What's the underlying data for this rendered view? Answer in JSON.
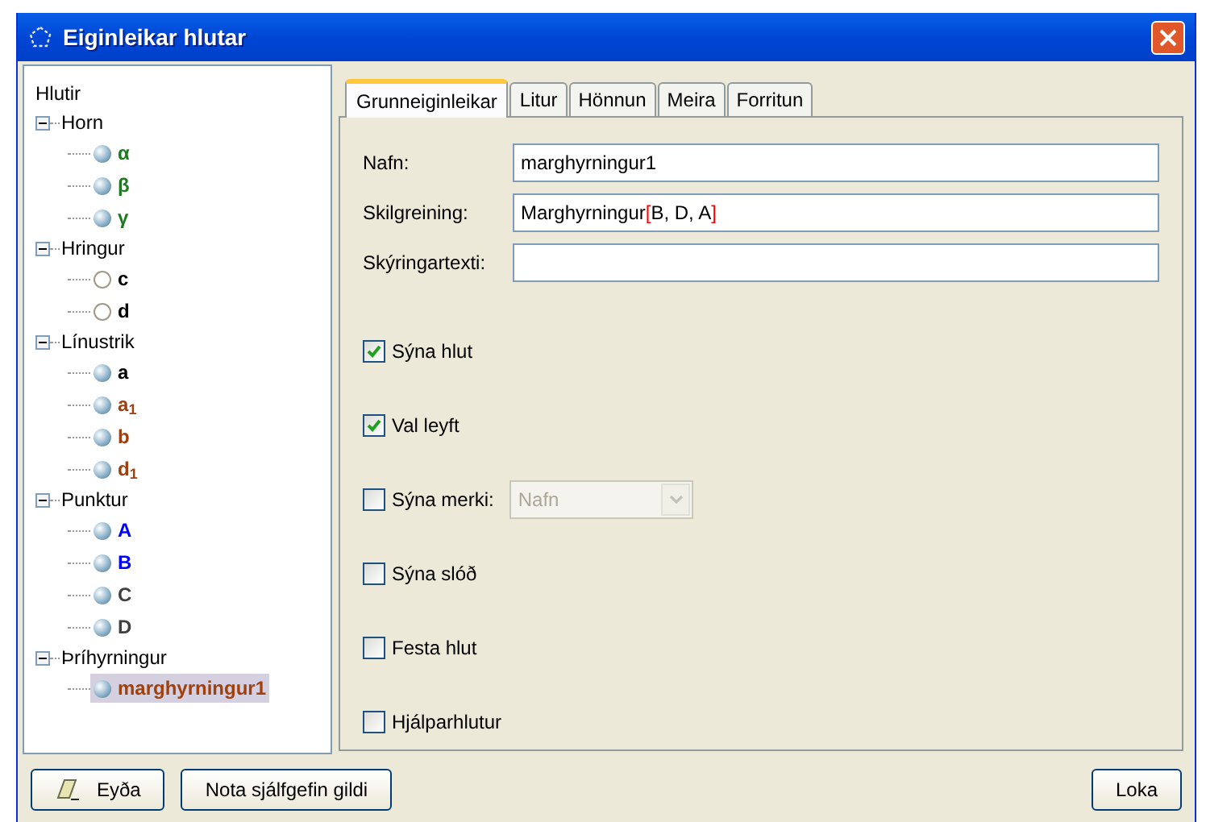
{
  "window": {
    "title": "Eiginleikar hlutar"
  },
  "tree": {
    "label": "Hlutir",
    "groups": [
      {
        "label": "Horn",
        "expanded": true,
        "children": [
          {
            "label": "α",
            "color": "#1e7a1e",
            "shown": true,
            "selected": false
          },
          {
            "label": "β",
            "color": "#1e7a1e",
            "shown": true,
            "selected": false
          },
          {
            "label": "γ",
            "color": "#1e7a1e",
            "shown": true,
            "selected": false
          }
        ]
      },
      {
        "label": "Hringur",
        "expanded": true,
        "children": [
          {
            "label": "c",
            "color": "#000000",
            "shown": false,
            "selected": false
          },
          {
            "label": "d",
            "color": "#000000",
            "shown": false,
            "selected": false
          }
        ]
      },
      {
        "label": "Línustrik",
        "expanded": true,
        "children": [
          {
            "label": "a",
            "color": "#000000",
            "shown": true,
            "selected": false
          },
          {
            "label": "a$_{1}$",
            "color": "#a0400f",
            "shown": true,
            "selected": false
          },
          {
            "label": "b",
            "color": "#a0400f",
            "shown": true,
            "selected": false
          },
          {
            "label": "d$_{1}$",
            "color": "#a0400f",
            "shown": true,
            "selected": false
          }
        ]
      },
      {
        "label": "Punktur",
        "expanded": true,
        "children": [
          {
            "label": "A",
            "color": "#0000ff",
            "shown": true,
            "selected": false
          },
          {
            "label": "B",
            "color": "#0000ff",
            "shown": true,
            "selected": false
          },
          {
            "label": "C",
            "color": "#404040",
            "shown": true,
            "selected": false
          },
          {
            "label": "D",
            "color": "#404040",
            "shown": true,
            "selected": false
          }
        ]
      },
      {
        "label": "Þríhyrningur",
        "expanded": true,
        "children": [
          {
            "label": "marghyrningur1",
            "color": "#a0400f",
            "shown": true,
            "selected": true
          }
        ]
      }
    ]
  },
  "tabs": [
    {
      "label": "Grunneiginleikar",
      "selected": true
    },
    {
      "label": "Litur",
      "selected": false
    },
    {
      "label": "Hönnun",
      "selected": false
    },
    {
      "label": "Meira",
      "selected": false
    },
    {
      "label": "Forritun",
      "selected": false
    }
  ],
  "fields": [
    {
      "label": "Nafn:",
      "segments": [
        {
          "text": "marghyrningur1",
          "kind": "plain"
        }
      ]
    },
    {
      "label": "Skilgreining:",
      "segments": [
        {
          "text": "Marghyrningur",
          "kind": "plain"
        },
        {
          "text": "[",
          "kind": "bracket"
        },
        {
          "text": "B, D, A",
          "kind": "plain"
        },
        {
          "text": "]",
          "kind": "bracket"
        }
      ]
    },
    {
      "label": "Skýringartexti:"
    }
  ],
  "checkboxes": [
    {
      "label": "Sýna hlut",
      "checked": true
    },
    {
      "label": "Val leyft",
      "checked": true
    },
    {
      "label": "Sýna merki:",
      "checked": false,
      "dropdown": {
        "value": "Nafn",
        "disabled": true
      }
    },
    {
      "label": "Sýna slóð",
      "checked": false
    },
    {
      "label": "Festa hlut",
      "checked": false
    },
    {
      "label": "Hjálparhlutur",
      "checked": false
    }
  ],
  "buttons": [
    {
      "label": "Eyða",
      "kind": "delete"
    },
    {
      "label": "Nota sjálfgefin gildi",
      "kind": "plain"
    },
    {
      "label": "Loka",
      "kind": "plain"
    }
  ]
}
